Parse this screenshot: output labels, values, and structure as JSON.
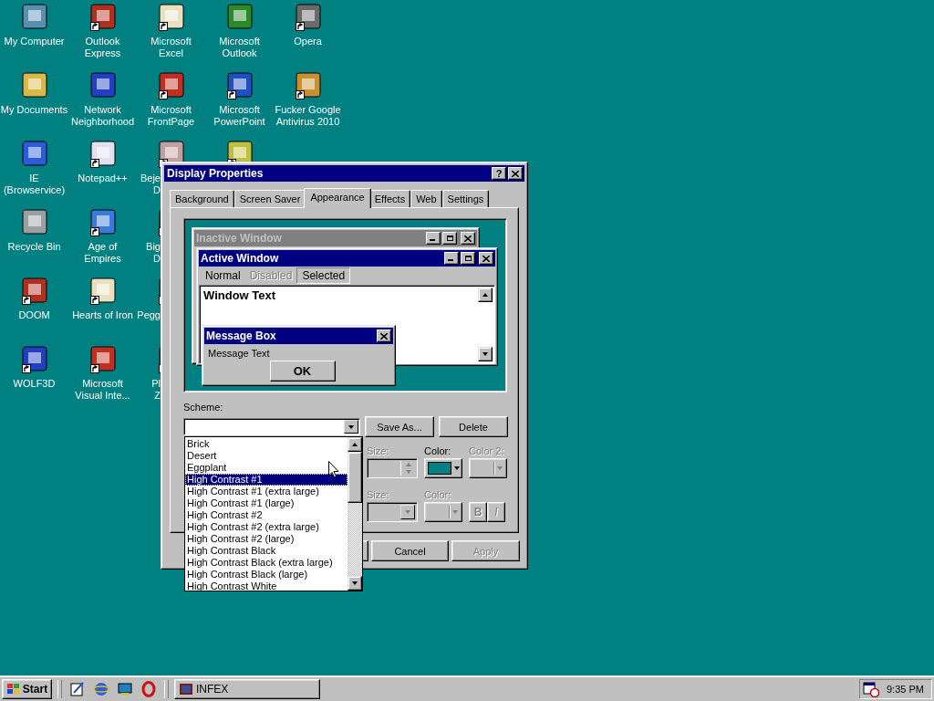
{
  "desktop": {
    "icon_columns": [
      [
        {
          "kind": "full",
          "label": "My Computer",
          "shortcut": false
        },
        {
          "kind": "full",
          "label": "My Documents",
          "shortcut": false
        },
        {
          "kind": "full",
          "label": "IE (Browservice)",
          "shortcut": false
        },
        {
          "kind": "full",
          "label": "Recycle Bin",
          "shortcut": false
        },
        {
          "kind": "full",
          "label": "DOOM",
          "shortcut": true
        },
        {
          "kind": "full",
          "label": "WOLF3D",
          "shortcut": true
        }
      ],
      [
        {
          "kind": "full",
          "label": "Outlook Express",
          "shortcut": true
        },
        {
          "kind": "full",
          "label": "Network Neighborhood",
          "shortcut": false
        },
        {
          "kind": "full",
          "label": "Notepad++",
          "shortcut": true
        },
        {
          "kind": "full",
          "label": "Age of Empires",
          "shortcut": true
        },
        {
          "kind": "full",
          "label": "Hearts of Iron",
          "shortcut": true
        },
        {
          "kind": "full",
          "label": "Microsoft Visual Inte...",
          "shortcut": true
        }
      ],
      [
        {
          "kind": "full",
          "label": "Microsoft Excel",
          "shortcut": true
        },
        {
          "kind": "full",
          "label": "Microsoft FrontPage",
          "shortcut": true
        },
        {
          "kind": "partial",
          "lines": [
            "Beje",
            "D"
          ],
          "shortcut": true
        },
        {
          "kind": "partial",
          "lines": [
            "Big",
            "D"
          ],
          "shortcut": true
        },
        {
          "kind": "partial",
          "lines": [
            "Pegg"
          ],
          "shortcut": true
        },
        {
          "kind": "partial",
          "lines": [
            "Pl",
            "Z"
          ],
          "shortcut": true
        }
      ],
      [
        {
          "kind": "full",
          "label": "Microsoft Outlook",
          "shortcut": false
        },
        {
          "kind": "full",
          "label": "Microsoft PowerPoint",
          "shortcut": true
        },
        {
          "kind": "partial",
          "shortcut": true
        }
      ],
      [
        {
          "kind": "full",
          "label": "Opera",
          "shortcut": true
        },
        {
          "kind": "full",
          "label": "Fucker Google Antivirus 2010",
          "shortcut": true
        }
      ]
    ]
  },
  "dialog": {
    "title": "Display Properties",
    "help_button": "?",
    "tabs": [
      {
        "label": "Background",
        "selected": false
      },
      {
        "label": "Screen Saver",
        "selected": false
      },
      {
        "label": "Appearance",
        "selected": true
      },
      {
        "label": "Effects",
        "selected": false
      },
      {
        "label": "Web",
        "selected": false
      },
      {
        "label": "Settings",
        "selected": false
      }
    ],
    "preview": {
      "inactive_title": "Inactive Window",
      "active_title": "Active Window",
      "menu": [
        {
          "label": "Normal",
          "disabled": false,
          "selected": false
        },
        {
          "label": "Disabled",
          "disabled": true,
          "selected": false
        },
        {
          "label": "Selected",
          "disabled": false,
          "selected": true
        }
      ],
      "window_text": "Window Text",
      "message_title": "Message Box",
      "message_text": "Message Text",
      "message_button": "OK"
    },
    "scheme": {
      "label": "Scheme:",
      "buttons": [
        "Save As...",
        "Delete"
      ],
      "options": [
        {
          "label": "Brick",
          "selected": false
        },
        {
          "label": "Desert",
          "selected": false
        },
        {
          "label": "Eggplant",
          "selected": false
        },
        {
          "label": "High Contrast #1",
          "selected": true
        },
        {
          "label": "High Contrast #1 (extra large)",
          "selected": false
        },
        {
          "label": "High Contrast #1 (large)",
          "selected": false
        },
        {
          "label": "High Contrast #2",
          "selected": false
        },
        {
          "label": "High Contrast #2 (extra large)",
          "selected": false
        },
        {
          "label": "High Contrast #2 (large)",
          "selected": false
        },
        {
          "label": "High Contrast Black",
          "selected": false
        },
        {
          "label": "High Contrast Black (extra large)",
          "selected": false
        },
        {
          "label": "High Contrast Black (large)",
          "selected": false
        },
        {
          "label": "High Contrast White",
          "selected": false
        }
      ]
    },
    "item_controls": [
      {
        "kind": "spinner",
        "label": "Size:",
        "disabled": true
      },
      {
        "kind": "color",
        "label": "Color:",
        "disabled": false,
        "color": "#008080"
      },
      {
        "kind": "dropdown",
        "label": "Color 2:",
        "disabled": true
      }
    ],
    "font_controls": [
      {
        "kind": "dropdown",
        "label": "Size:",
        "disabled": true
      },
      {
        "kind": "dropdown",
        "label": "Color:",
        "disabled": true
      },
      {
        "kind": "toggle",
        "text": "B",
        "disabled": true
      },
      {
        "kind": "toggle",
        "text": "I",
        "disabled": true
      }
    ],
    "buttons": [
      {
        "label": "Cancel",
        "disabled": false
      },
      {
        "label": "Apply",
        "disabled": true
      }
    ]
  },
  "taskbar": {
    "start": "Start",
    "tasks": [
      {
        "label": "INFEX",
        "selected": false
      }
    ],
    "clock": "9:35 PM"
  }
}
